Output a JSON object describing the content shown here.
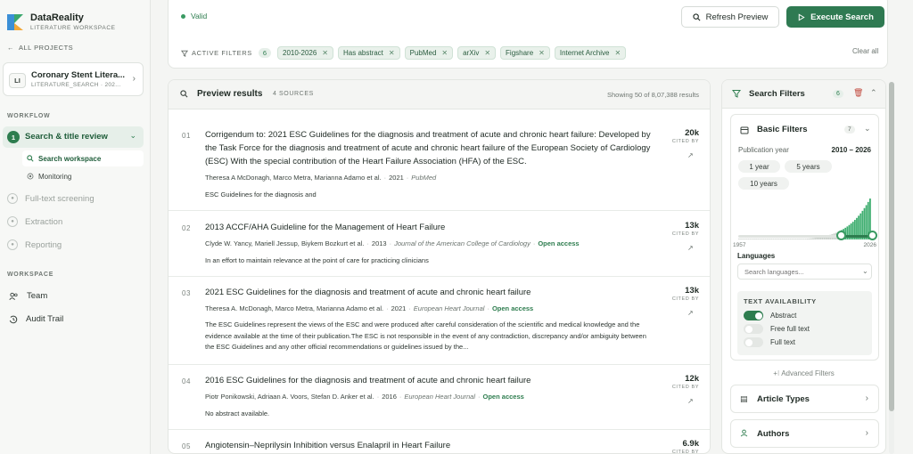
{
  "brand": {
    "name": "DataReality",
    "subtitle": "LITERATURE WORKSPACE"
  },
  "nav": {
    "all_projects": "ALL PROJECTS"
  },
  "project": {
    "avatar": "LI",
    "title": "Coronary Stent Litera...",
    "subtitle": "LITERATURE_SEARCH · 202..."
  },
  "workflow": {
    "label": "WORKFLOW",
    "active": {
      "step": "1",
      "label": "Search & title review"
    },
    "sub": [
      {
        "label": "Search workspace"
      },
      {
        "label": "Monitoring"
      }
    ],
    "disabled": [
      {
        "label": "Full-text screening"
      },
      {
        "label": "Extraction"
      },
      {
        "label": "Reporting"
      }
    ]
  },
  "workspace": {
    "label": "WORKSPACE",
    "items": [
      {
        "label": "Team"
      },
      {
        "label": "Audit Trail"
      }
    ]
  },
  "status": {
    "label": "Valid"
  },
  "toolbar": {
    "refresh": "Refresh Preview",
    "execute": "Execute Search"
  },
  "filters": {
    "label": "ACTIVE FILTERS",
    "count": "6",
    "chips": [
      "2010-2026",
      "Has abstract",
      "PubMed",
      "arXiv",
      "Figshare",
      "Internet Archive"
    ],
    "clear_all": "Clear all"
  },
  "results": {
    "title": "Preview results",
    "sources": "4 SOURCES",
    "showing": "Showing 50 of 8,07,388 results",
    "cited_label": "CITED BY",
    "items": [
      {
        "idx": "01",
        "title": "Corrigendum to: 2021 ESC Guidelines for the diagnosis and treatment of acute and chronic heart failure: Developed by the Task Force for the diagnosis and treatment of acute and chronic heart failure of the European Society of Cardiology (ESC) With the special contribution of the Heart Failure Association (HFA) of the ESC.",
        "authors": "Theresa A McDonagh, Marco Metra, Marianna Adamo et al.",
        "year": "2021",
        "journal": "PubMed",
        "oa": "",
        "abstract": "ESC Guidelines for the diagnosis and",
        "cites": "20k"
      },
      {
        "idx": "02",
        "title": "2013 ACCF/AHA Guideline for the Management of Heart Failure",
        "authors": "Clyde W. Yancy, Mariell Jessup, Biykem Bozkurt et al.",
        "year": "2013",
        "journal": "Journal of the American College of Cardiology",
        "oa": "Open access",
        "abstract": "In an effort to maintain relevance at the point of care for practicing clinicians",
        "cites": "13k"
      },
      {
        "idx": "03",
        "title": "2021 ESC Guidelines for the diagnosis and treatment of acute and chronic heart failure",
        "authors": "Theresa A. McDonagh, Marco Metra, Marianna Adamo et al.",
        "year": "2021",
        "journal": "European Heart Journal",
        "oa": "Open access",
        "abstract": "The ESC Guidelines represent the views of the ESC and were produced after careful consideration of the scientific and medical knowledge and the evidence available at the time of their publication.The ESC is not responsible in the event of any contradiction, discrepancy and/or ambiguity between the ESC Guidelines and any other official recommendations or guidelines issued by the...",
        "cites": "13k"
      },
      {
        "idx": "04",
        "title": "2016 ESC Guidelines for the diagnosis and treatment of acute and chronic heart failure",
        "authors": "Piotr Ponikowski, Adriaan A. Voors, Stefan D. Anker et al.",
        "year": "2016",
        "journal": "European Heart Journal",
        "oa": "Open access",
        "abstract": "No abstract available.",
        "cites": "12k"
      },
      {
        "idx": "05",
        "title": "Angiotensin–Neprilysin Inhibition versus Enalapril in Heart Failure",
        "authors": "",
        "year": "",
        "journal": "",
        "oa": "",
        "abstract": "",
        "cites": "6.9k"
      }
    ]
  },
  "panel": {
    "title": "Search Filters",
    "count": "6",
    "basic": {
      "title": "Basic Filters",
      "count": "7",
      "pub_label": "Publication year",
      "pub_value": "2010 – 2026",
      "presets": [
        "1 year",
        "5 years",
        "10 years"
      ],
      "year_min": "1957",
      "year_max": "2026",
      "range_start": 2010,
      "range_end": 2026,
      "lang_label": "Languages",
      "lang_placeholder": "Search languages...",
      "ta_label": "TEXT AVAILABILITY",
      "toggles": [
        {
          "label": "Abstract",
          "on": true
        },
        {
          "label": "Free full text",
          "on": false
        },
        {
          "label": "Full text",
          "on": false
        }
      ]
    },
    "advanced": "Advanced Filters",
    "sections": [
      {
        "label": "Article Types"
      },
      {
        "label": "Authors"
      }
    ]
  },
  "colors": {
    "accent": "#2e7d4f",
    "accent_light": "#e6efe9",
    "danger": "#c0463b"
  }
}
